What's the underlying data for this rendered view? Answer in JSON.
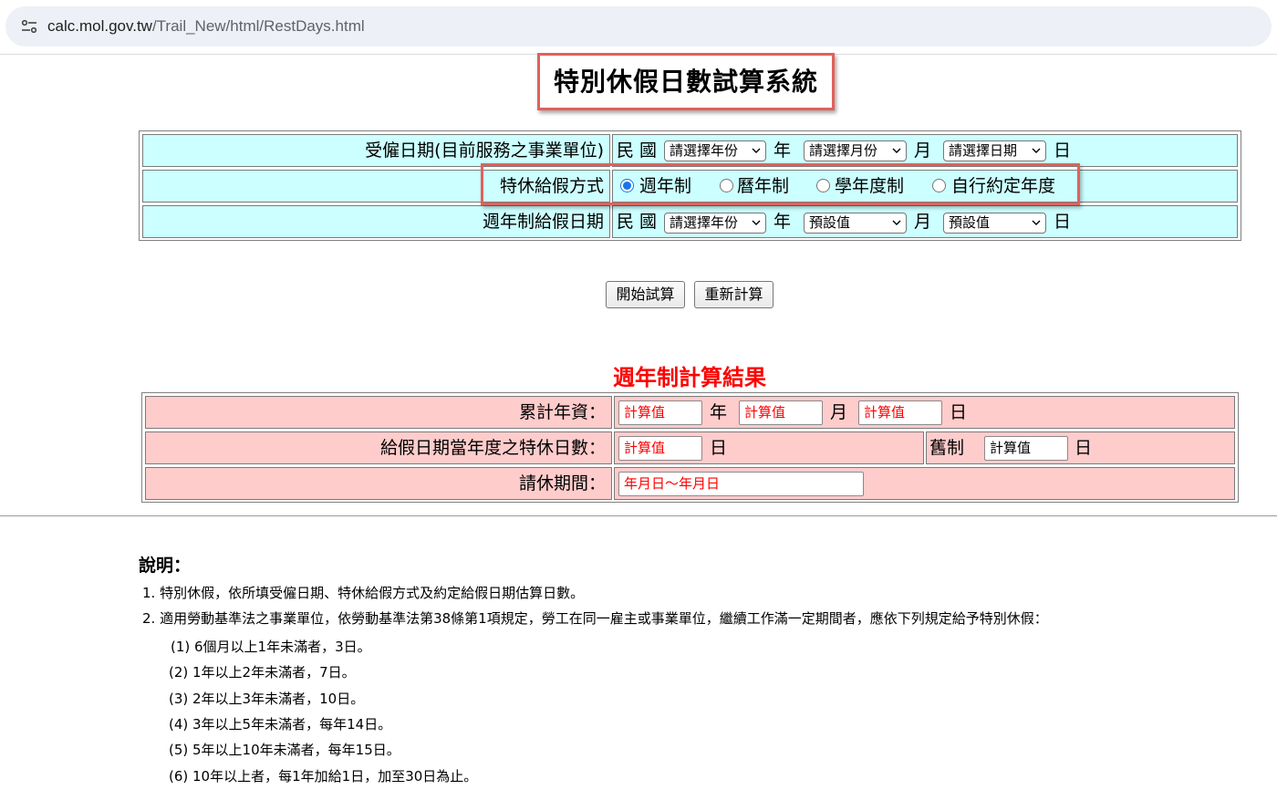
{
  "browser": {
    "url_host": "calc.mol.gov.tw",
    "url_path": "/Trail_New/html/RestDays.html"
  },
  "page_title": "特別休假日數試算系統",
  "form": {
    "hire_date": {
      "label": "受僱日期(目前服務之事業單位)",
      "prefix": "民 國",
      "year_select": "請選擇年份",
      "year_unit": "年",
      "month_select": "請選擇月份",
      "month_unit": "月",
      "day_select": "請選擇日期",
      "day_unit": "日"
    },
    "leave_method": {
      "label": "特休給假方式",
      "options": [
        {
          "label": "週年制",
          "checked": true
        },
        {
          "label": "曆年制",
          "checked": false
        },
        {
          "label": "學年度制",
          "checked": false
        },
        {
          "label": "自行約定年度",
          "checked": false
        }
      ]
    },
    "grant_date": {
      "label": "週年制給假日期",
      "prefix": "民 國",
      "year_select": "請選擇年份",
      "year_unit": "年",
      "month_select": "預設值",
      "month_unit": "月",
      "day_select": "預設值",
      "day_unit": "日"
    }
  },
  "buttons": {
    "start": "開始試算",
    "reset": "重新計算"
  },
  "result": {
    "title": "週年制計算結果",
    "seniority": {
      "label": "累計年資：",
      "year_value": "計算值",
      "year_unit": "年",
      "month_value": "計算值",
      "month_unit": "月",
      "day_value": "計算值",
      "day_unit": "日"
    },
    "leave_days": {
      "label": "給假日期當年度之特休日數：",
      "value": "計算值",
      "unit": "日",
      "old_label": "舊制",
      "old_value": "計算值",
      "old_unit": "日"
    },
    "leave_period": {
      "label": "請休期間：",
      "value": "年月日～年月日"
    }
  },
  "notes": {
    "heading": "說明：",
    "items": [
      "1. 特別休假，依所填受僱日期、特休給假方式及約定給假日期估算日數。",
      "2. 適用勞動基準法之事業單位，依勞動基準法第38條第1項規定，勞工在同一雇主或事業單位，繼續工作滿一定期間者，應依下列規定給予特別休假："
    ],
    "sub_items": [
      "(1) 6個月以上1年未滿者，3日。",
      "(2) 1年以上2年未滿者，7日。",
      "(3) 2年以上3年未滿者，10日。",
      "(4) 3年以上5年未滿者，每年14日。",
      "(5) 5年以上10年未滿者，每年15日。",
      "(6) 10年以上者，每1年加給1日，加至30日為止。"
    ]
  }
}
